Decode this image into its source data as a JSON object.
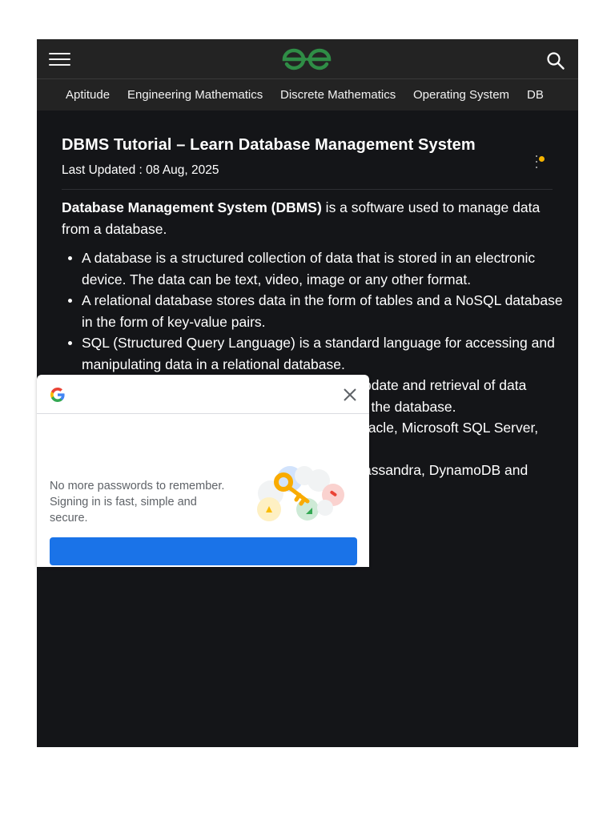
{
  "header": {
    "menu_icon": "hamburger-menu-icon",
    "logo_icon": "geeksforgeeks-logo",
    "search_icon": "search-icon",
    "background": "#232323"
  },
  "nav": {
    "items": [
      {
        "label": "Aptitude"
      },
      {
        "label": "Engineering Mathematics"
      },
      {
        "label": "Discrete Mathematics"
      },
      {
        "label": "Operating System"
      },
      {
        "label": "DB"
      }
    ]
  },
  "article": {
    "title": "DBMS Tutorial – Learn Database Management System",
    "last_updated": "Last Updated : 08 Aug, 2025",
    "intro_bold": "Database Management System (DBMS)",
    "intro_rest": " is a software used to manage data from a database.",
    "bullets": [
      "A database is a structured collection of data that is stored in an electronic device. The data can be text, video, image or any other format.",
      "A relational database stores data in the form of tables and a NoSQL database in the form of key-value pairs.",
      "SQL (Structured Query Language) is a standard language for accessing and manipulating data in a relational database.",
      "pdate and retrieval of data",
      "to the database.",
      "racle, Microsoft SQL Server,",
      "assandra, DynamoDB and"
    ],
    "notification_color": "#f5b300"
  },
  "popup": {
    "google_icon": "google-g-icon",
    "close_icon": "close-icon",
    "message": "No more passwords to remember. Signing in is fast, simple and secure.",
    "illustration": "password-key-illustration",
    "button_label": "",
    "button_color": "#1a73e8"
  },
  "colors": {
    "page_background": "#141518",
    "logo_green": "#2f8d46"
  }
}
